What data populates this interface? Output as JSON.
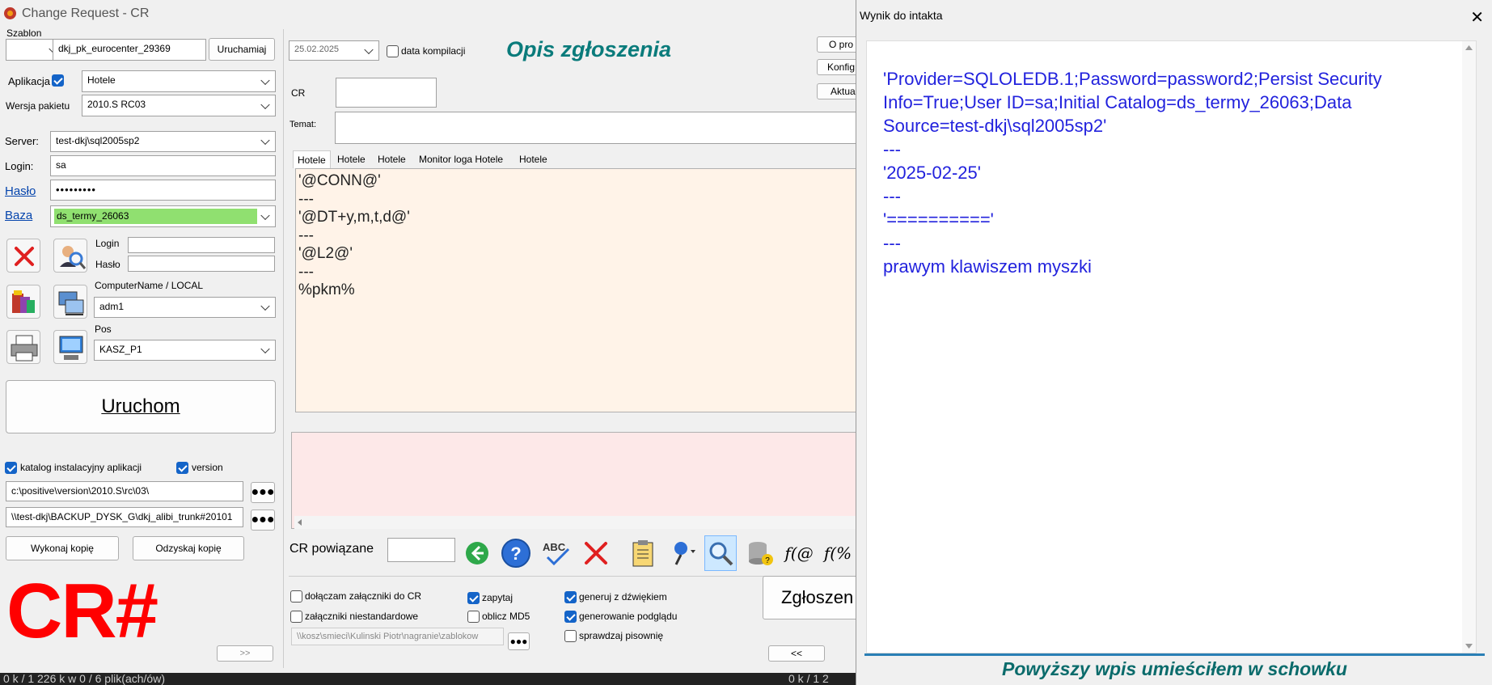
{
  "window": {
    "title": "Change Request - CR"
  },
  "left": {
    "szablon_label": "Szablon",
    "szablon_value": "dkj_pk_eurocenter_29369",
    "uruchamiaj_label": "Uruchamiaj",
    "aplikacja_label": "Aplikacja",
    "aplikacja_value": "Hotele",
    "wersja_label": "Wersja pakietu",
    "wersja_value": "2010.S RC03",
    "server_label": "Server:",
    "server_value": "test-dkj\\sql2005sp2",
    "login_label": "Login:",
    "login_value": "sa",
    "haslo_label": "Hasło",
    "haslo_value": "•••••••••",
    "baza_label": "Baza",
    "baza_value": "ds_termy_26063",
    "login2_label": "Login",
    "haslo2_label": "Hasło",
    "computer_label": "ComputerName / LOCAL",
    "computer_value": "adm1",
    "pos_label": "Pos",
    "pos_value": "KASZ_P1",
    "uruchom_label": "Uruchom",
    "katalog_label": "katalog instalacyjny aplikacji",
    "version_label": "version",
    "path1": "c:\\positive\\version\\2010.S\\rc\\03\\",
    "path2": "\\\\test-dkj\\BACKUP_DYSK_G\\dkj_alibi_trunk#20101",
    "wykonaj_label": "Wykonaj kopię",
    "odzyskaj_label": "Odzyskaj kopię",
    "crhash": "CR#",
    "nav_next": ">>"
  },
  "middle": {
    "date_value": "25.02.2025",
    "data_kompilacji": "data kompilacji",
    "opis": "Opis zgłoszenia",
    "btn_o_pro": "O pro",
    "btn_konfig": "Konfig",
    "btn_aktua": "Aktua",
    "cr_label": "CR",
    "temat_label": "Temat:",
    "tabs": [
      "Hotele",
      "Hotele",
      "Hotele",
      "Monitor loga Hotele",
      "Hotele"
    ],
    "script_lines": [
      "'@CONN@'",
      "---",
      "'@DT+y,m,t,d@'",
      "---",
      "'@L2@'",
      "---",
      "%pkm%"
    ],
    "cr_powiazane": "CR powiązane",
    "opt_zalaczniki": "dołączam załączniki do CR",
    "opt_niestandardowe": "załączniki niestandardowe",
    "opt_zapytaj": "zapytaj",
    "opt_md5": "oblicz MD5",
    "opt_dzwiek": "generuj z dźwiękiem",
    "opt_podglad": "generowanie podglądu",
    "opt_pisownia": "sprawdzaj pisownię",
    "path3": "\\\\kosz\\smieci\\Kulinski Piotr\\nagranie\\zablokow",
    "zglosz": "Zgłoszen",
    "nav_prev": "<<"
  },
  "overlay": {
    "title": "Wynik do intakta",
    "close": "✕",
    "lines": [
      "'Provider=SQLOLEDB.1;Password=password2;Persist Security",
      "Info=True;User ID=sa;Initial Catalog=ds_termy_26063;Data",
      "Source=test-dkj\\sql2005sp2'",
      "---",
      "'2025-02-25'",
      "---",
      "'=========='",
      "---",
      "prawym klawiszem myszki"
    ],
    "footer": "Powyższy wpis umieściłem w schowku"
  },
  "status": {
    "left": "0 k / 1 226 k w 0 / 6 plik(ach/ów)",
    "right": "0 k / 1 2"
  },
  "colors": {
    "baza_bg": "#90e070",
    "cr_red": "#ff0000",
    "opis_teal": "#0a7b7b",
    "overlay_text": "#2222dd"
  }
}
